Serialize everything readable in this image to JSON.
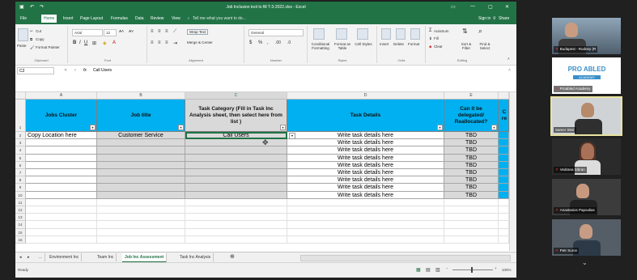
{
  "window": {
    "title": "Job Inclusion tool to fill T-3-2022.xlsx - Excel",
    "signin": "Sign in",
    "share": "Share"
  },
  "menu": {
    "items": [
      "File",
      "Home",
      "Insert",
      "Page Layout",
      "Formulas",
      "Data",
      "Review",
      "View"
    ],
    "tell_me": "Tell me what you want to do..."
  },
  "ribbon": {
    "clipboard": {
      "cut": "Cut",
      "copy": "Copy",
      "format_painter": "Format Painter",
      "paste": "Paste",
      "label": "Clipboard"
    },
    "font": {
      "name": "Arial",
      "size": "12",
      "label": "Font"
    },
    "alignment": {
      "wrap": "Wrap Text",
      "merge": "Merge & Center",
      "label": "Alignment"
    },
    "number": {
      "format": "General",
      "label": "Number"
    },
    "styles": {
      "conditional": "Conditional Formatting",
      "format_table": "Format as Table",
      "cell_styles": "Cell Styles",
      "label": "Styles"
    },
    "cells": {
      "insert": "Insert",
      "delete": "Delete",
      "format": "Format",
      "label": "Cells"
    },
    "editing": {
      "autosum": "AutoSum",
      "fill": "Fill",
      "clear": "Clear",
      "sort": "Sort & Filter",
      "find": "Find & Select",
      "label": "Editing"
    }
  },
  "formula_bar": {
    "name_box": "C2",
    "fx": "fx",
    "content": "Call Users"
  },
  "columns": [
    "A",
    "B",
    "C",
    "D",
    "E"
  ],
  "headers": {
    "a": "Jobs Cluster",
    "b": "Job title",
    "c": "Task Category (Fill in Task Inc Analysis sheet, then select here from list )",
    "d": "Task Details",
    "e": "Can it be delegated/ Reallocated?",
    "f": "C re"
  },
  "rows": [
    {
      "num": "2",
      "a": "Copy Location here",
      "b": "Customer Service",
      "c": "Call Users",
      "d": "Write task details here",
      "e": "TBD"
    },
    {
      "num": "3",
      "a": "",
      "b": "",
      "c": "",
      "d": "Write task details here",
      "e": "TBD"
    },
    {
      "num": "4",
      "a": "",
      "b": "",
      "c": "",
      "d": "Write task details here",
      "e": "TBD"
    },
    {
      "num": "5",
      "a": "",
      "b": "",
      "c": "",
      "d": "Write task details here",
      "e": "TBD"
    },
    {
      "num": "6",
      "a": "",
      "b": "",
      "c": "",
      "d": "Write task details here",
      "e": "TBD"
    },
    {
      "num": "7",
      "a": "",
      "b": "",
      "c": "",
      "d": "Write task details here",
      "e": "TBD"
    },
    {
      "num": "8",
      "a": "",
      "b": "",
      "c": "",
      "d": "Write task details here",
      "e": "TBD"
    },
    {
      "num": "9",
      "a": "",
      "b": "",
      "c": "",
      "d": "Write task details here",
      "e": "TBD"
    },
    {
      "num": "10",
      "a": "",
      "b": "",
      "c": "",
      "d": "Write task details here",
      "e": "TBD"
    }
  ],
  "empty_rows": [
    "11",
    "12",
    "13",
    "14",
    "15",
    "16"
  ],
  "sheet_tabs": [
    "Environment Inc",
    "Team Inc",
    "Job Inc Assessment",
    "Task Inc Analysis"
  ],
  "active_tab": "Job Inc Assessment",
  "status": {
    "ready": "Ready",
    "zoom": "100%"
  },
  "participants": [
    {
      "name": "Budapest - Rodney (R"
    },
    {
      "name": "Proabled Academy",
      "logo_text": "PRO ABLED",
      "logo_sub": "ACADEMY"
    },
    {
      "name": "Samer Sleir"
    },
    {
      "name": "Vedrana Sibran"
    },
    {
      "name": "Anastasios Papoulias"
    },
    {
      "name": "Petr Surov"
    }
  ],
  "colors": {
    "excel_green": "#217346",
    "header_blue": "#00b0f0",
    "gray_fill": "#d9d9d9"
  }
}
